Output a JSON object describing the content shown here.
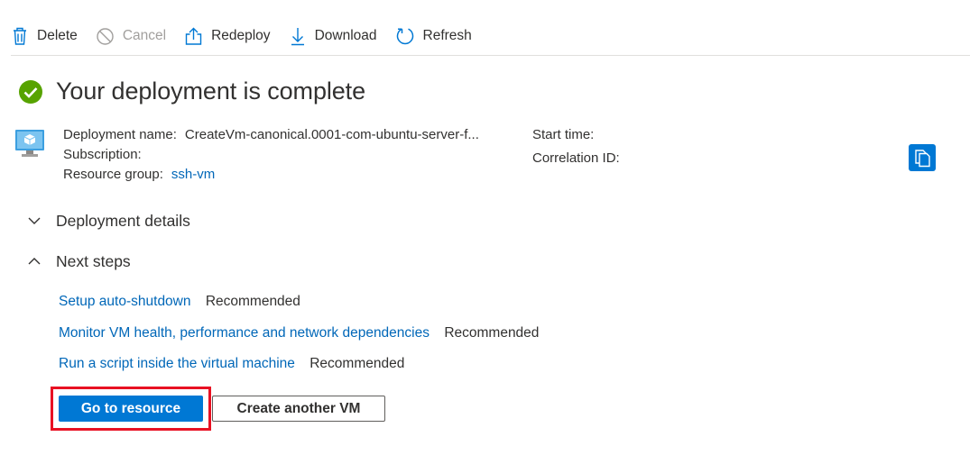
{
  "toolbar": {
    "delete": "Delete",
    "cancel": "Cancel",
    "redeploy": "Redeploy",
    "download": "Download",
    "refresh": "Refresh"
  },
  "header": {
    "title": "Your deployment is complete",
    "status_icon": "success-check-icon",
    "status_color": "#57a300"
  },
  "info": {
    "deployment_name_label": "Deployment name:",
    "deployment_name_value": "CreateVm-canonical.0001-com-ubuntu-server-f...",
    "subscription_label": "Subscription:",
    "resource_group_label": "Resource group:",
    "resource_group_value": "ssh-vm",
    "start_time_label": "Start time:",
    "correlation_id_label": "Correlation ID:"
  },
  "sections": {
    "deployment_details": "Deployment details",
    "next_steps": "Next steps"
  },
  "next_steps": [
    {
      "link": "Setup auto-shutdown",
      "tag": "Recommended"
    },
    {
      "link": "Monitor VM health, performance and network dependencies",
      "tag": "Recommended"
    },
    {
      "link": "Run a script inside the virtual machine",
      "tag": "Recommended"
    }
  ],
  "actions": {
    "go_to_resource": "Go to resource",
    "create_another_vm": "Create another VM"
  },
  "colors": {
    "accent": "#0078d4",
    "link": "#0067b8",
    "highlight": "#e81123"
  }
}
